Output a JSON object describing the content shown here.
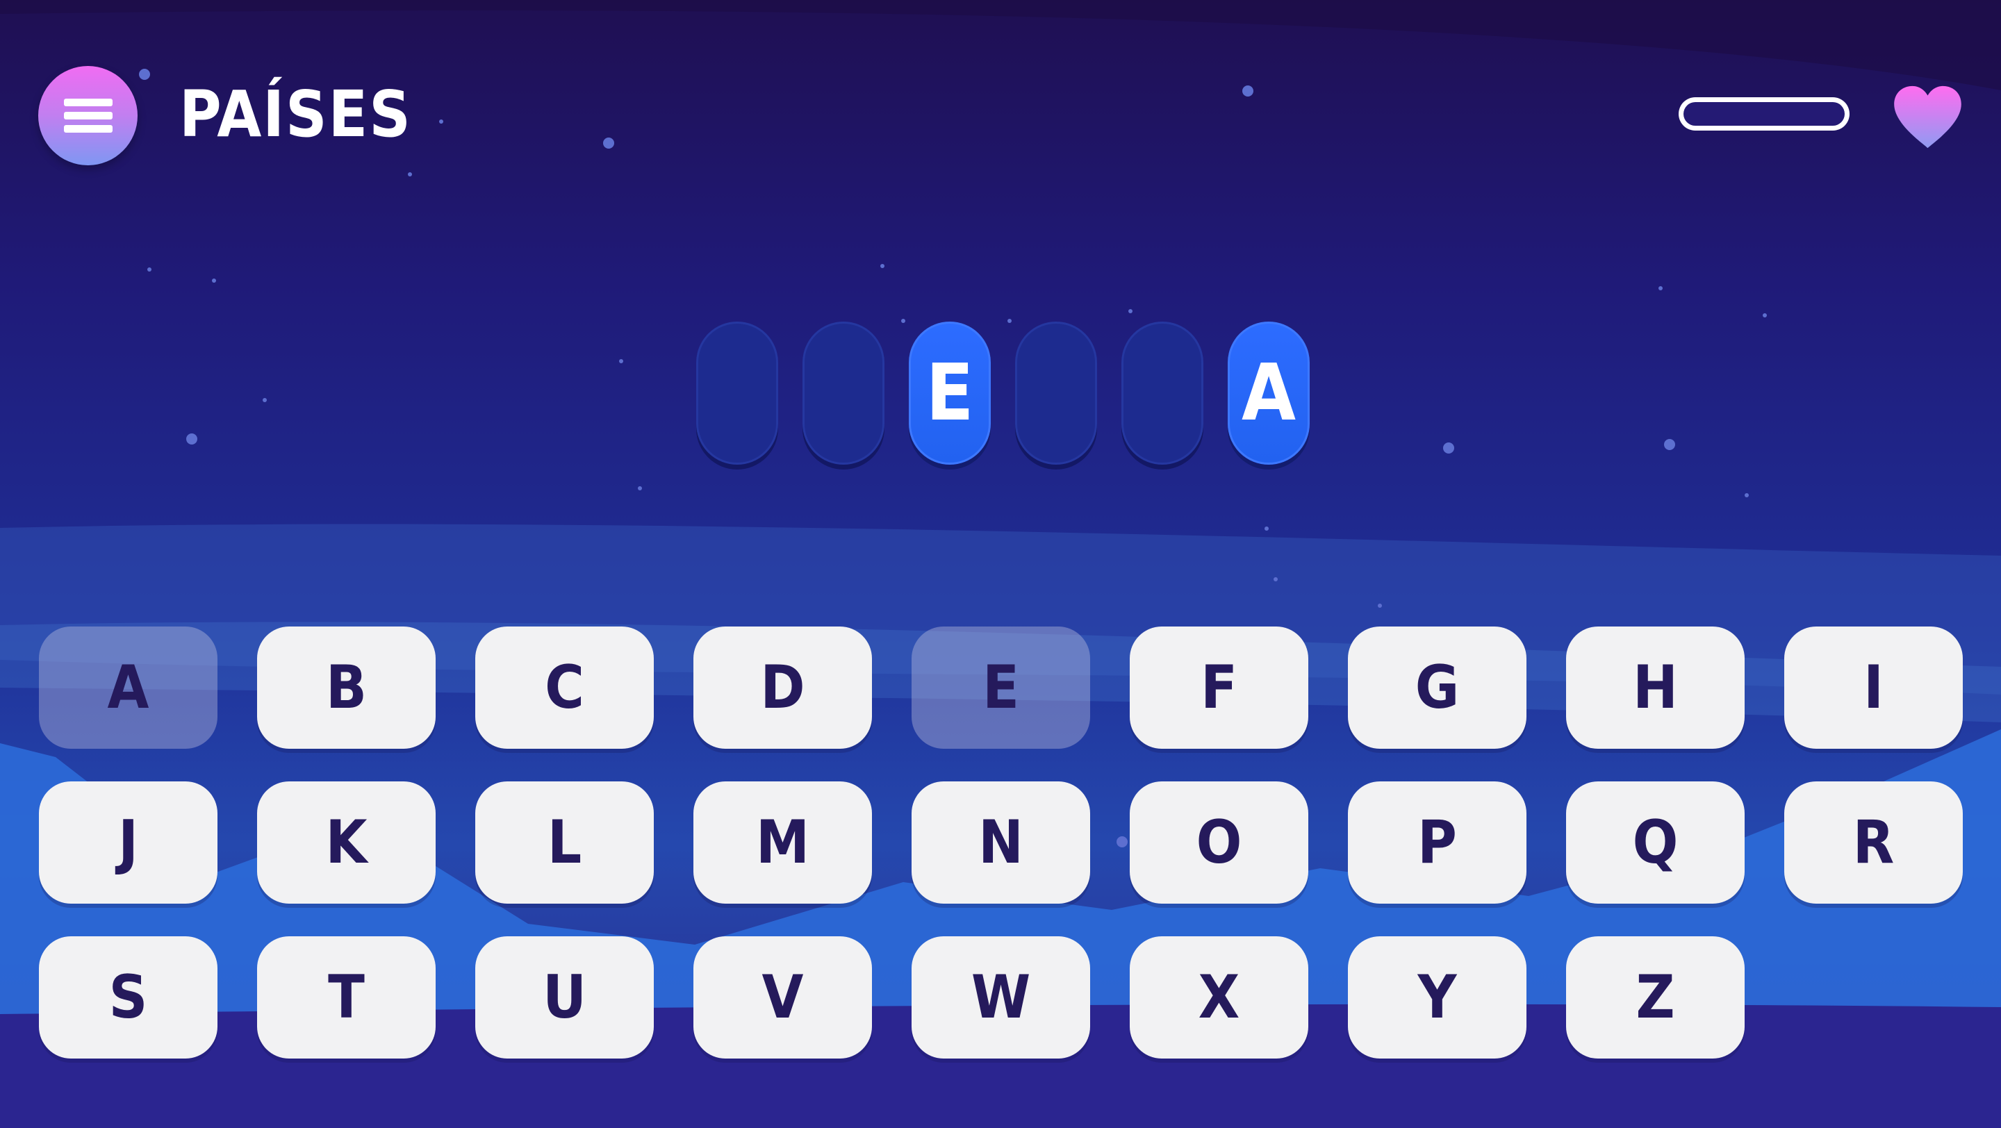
{
  "header": {
    "menu_icon": "hamburger-menu-icon",
    "category_title": "PAÍSES",
    "progress_fraction": 0.0,
    "life_icon": "heart-icon"
  },
  "colors": {
    "slot_filled": "#2766f7",
    "slot_empty": "#1d2b8f",
    "key_bg": "#f2f2f3",
    "key_text": "#251a5c",
    "heart_top": "#ff6cf0",
    "heart_bottom": "#8f9bf2"
  },
  "word_slots": [
    {
      "letter": "",
      "revealed": false
    },
    {
      "letter": "",
      "revealed": false
    },
    {
      "letter": "E",
      "revealed": true
    },
    {
      "letter": "",
      "revealed": false
    },
    {
      "letter": "",
      "revealed": false
    },
    {
      "letter": "A",
      "revealed": true
    }
  ],
  "keyboard": {
    "keys": [
      {
        "letter": "A",
        "used": true
      },
      {
        "letter": "B",
        "used": false
      },
      {
        "letter": "C",
        "used": false
      },
      {
        "letter": "D",
        "used": false
      },
      {
        "letter": "E",
        "used": true
      },
      {
        "letter": "F",
        "used": false
      },
      {
        "letter": "G",
        "used": false
      },
      {
        "letter": "H",
        "used": false
      },
      {
        "letter": "I",
        "used": false
      },
      {
        "letter": "J",
        "used": false
      },
      {
        "letter": "K",
        "used": false
      },
      {
        "letter": "L",
        "used": false
      },
      {
        "letter": "M",
        "used": false
      },
      {
        "letter": "N",
        "used": false
      },
      {
        "letter": "O",
        "used": false
      },
      {
        "letter": "P",
        "used": false
      },
      {
        "letter": "Q",
        "used": false
      },
      {
        "letter": "R",
        "used": false
      },
      {
        "letter": "S",
        "used": false
      },
      {
        "letter": "T",
        "used": false
      },
      {
        "letter": "U",
        "used": false
      },
      {
        "letter": "V",
        "used": false
      },
      {
        "letter": "W",
        "used": false
      },
      {
        "letter": "X",
        "used": false
      },
      {
        "letter": "Y",
        "used": false
      },
      {
        "letter": "Z",
        "used": false
      }
    ]
  }
}
